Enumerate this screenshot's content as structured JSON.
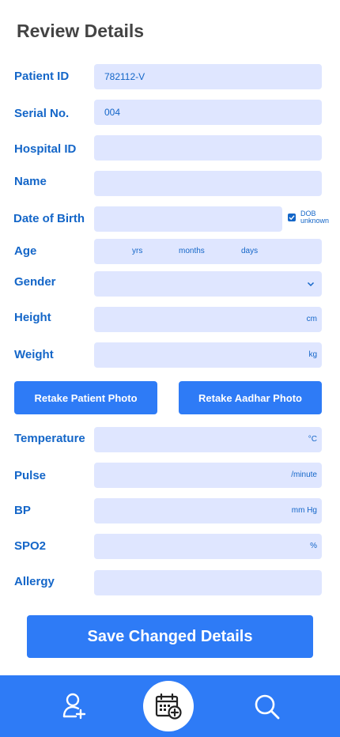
{
  "header": {
    "title": "Review Details"
  },
  "form": {
    "patient_id": {
      "label": "Patient ID",
      "value": "782112-V"
    },
    "serial_no": {
      "label": "Serial No.",
      "value": "004"
    },
    "hospital_id": {
      "label": "Hospital ID",
      "value": ""
    },
    "name": {
      "label": "Name",
      "value": ""
    },
    "dob": {
      "label": "Date of Birth",
      "value": "",
      "unknown_checked": true,
      "unknown_line1": "DOB",
      "unknown_line2": "unknown"
    },
    "age": {
      "label": "Age",
      "yrs": "yrs",
      "months": "months",
      "days": "days"
    },
    "gender": {
      "label": "Gender",
      "value": ""
    },
    "height": {
      "label": "Height",
      "unit": "cm"
    },
    "weight": {
      "label": "Weight",
      "unit": "kg"
    },
    "temperature": {
      "label": "Temperature",
      "unit": "°C"
    },
    "pulse": {
      "label": "Pulse",
      "unit": "/minute"
    },
    "bp": {
      "label": "BP",
      "unit": "mm Hg"
    },
    "spo2": {
      "label": "SPO2",
      "unit": "%"
    },
    "allergy": {
      "label": "Allergy",
      "value": ""
    }
  },
  "buttons": {
    "retake_patient": "Retake Patient Photo",
    "retake_aadhar": "Retake Aadhar Photo",
    "save": "Save Changed Details"
  },
  "nav": {
    "items": [
      {
        "icon": "add-patient-icon"
      },
      {
        "icon": "calendar-add-icon",
        "active": true
      },
      {
        "icon": "search-icon"
      }
    ]
  },
  "colors": {
    "primary": "#2e7bf6",
    "label": "#1466c8",
    "field_bg": "#dfe6ff",
    "title": "#444444"
  }
}
